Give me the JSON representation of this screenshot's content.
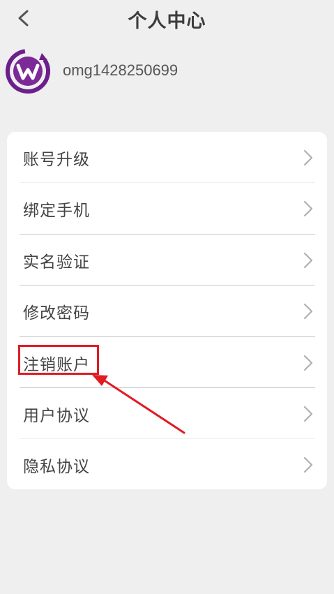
{
  "header": {
    "title": "个人中心"
  },
  "profile": {
    "username": "omg1428250699"
  },
  "menu": {
    "items": [
      {
        "label": "账号升级"
      },
      {
        "label": "绑定手机"
      },
      {
        "label": "实名验证"
      },
      {
        "label": "修改密码"
      },
      {
        "label": "注销账户"
      },
      {
        "label": "用户协议"
      },
      {
        "label": "隐私协议"
      }
    ]
  },
  "annotation": {
    "highlight_color": "#e01b22",
    "highlighted_item": "注销账户"
  },
  "icons": {
    "back": "back-arrow-icon",
    "chevron": "chevron-right-icon",
    "avatar": "brand-logo-avatar"
  },
  "colors": {
    "background": "#efefef",
    "card": "#ffffff",
    "avatar_purple": "#6b1f8a"
  }
}
